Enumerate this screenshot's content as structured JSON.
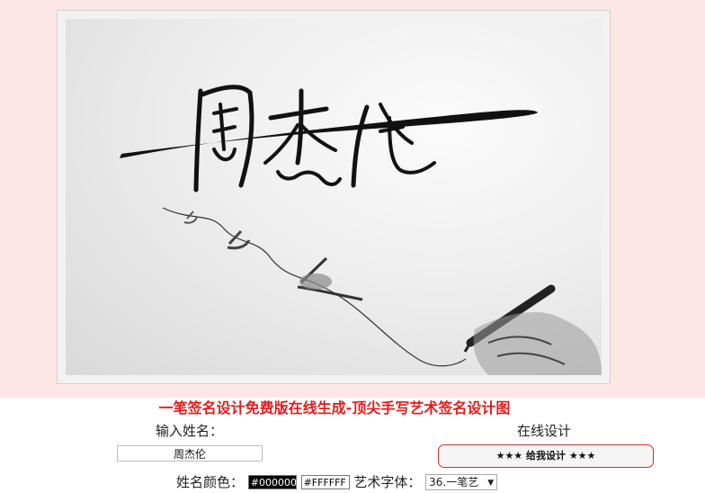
{
  "preview": {
    "signature_text": "周杰伦"
  },
  "headline": "一笔签名设计免费版在线生成-顶尖手写艺术签名设计图",
  "form": {
    "name_label": "输入姓名：",
    "name_value": "周杰伦",
    "design_label": "在线设计",
    "design_button": "★★★ 给我设计 ★★★",
    "color_label": "姓名颜色：",
    "name_color": "#000000",
    "bg_color": "#FFFFFF",
    "font_label": "艺术字体：",
    "font_selected": "36.一笔艺",
    "font_caret": "▼"
  },
  "colors": {
    "headline": "#e21c1c",
    "band": "#fde6e6",
    "button_border": "#d03030"
  },
  "icons": {
    "select_arrow": "chevron-down-icon"
  }
}
